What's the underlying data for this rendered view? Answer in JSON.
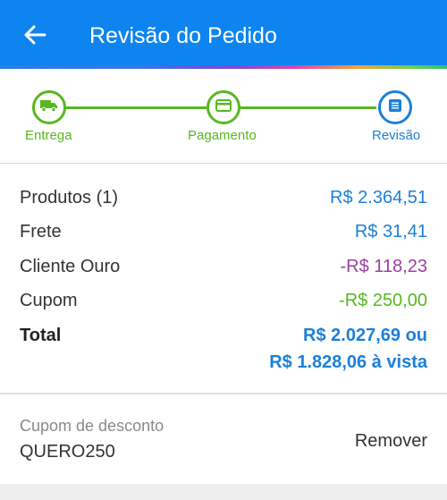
{
  "header": {
    "title": "Revisão do Pedido",
    "back_icon": "arrow-left-icon",
    "background": "#0d84f0"
  },
  "stepper": {
    "steps": [
      {
        "label": "Entrega",
        "icon": "truck-icon",
        "state": "done"
      },
      {
        "label": "Pagamento",
        "icon": "credit-card-icon",
        "state": "done"
      },
      {
        "label": "Revisão",
        "icon": "document-icon",
        "state": "current"
      }
    ],
    "done_color": "#57b820",
    "current_color": "#1d7fd8"
  },
  "summary": {
    "rows": [
      {
        "label": "Produtos (1)",
        "value": "R$ 2.364,51",
        "color": "#1d7fd8"
      },
      {
        "label": "Frete",
        "value": "R$ 31,41",
        "color": "#1d7fd8"
      },
      {
        "label": "Cliente Ouro",
        "value": "-R$ 118,23",
        "color": "#9b3fa0"
      },
      {
        "label": "Cupom",
        "value": "-R$ 250,00",
        "color": "#57b820"
      }
    ],
    "total": {
      "label": "Total",
      "value_line1": "R$ 2.027,69 ou",
      "value_line2": "R$ 1.828,06 à vista",
      "color": "#1d7fd8"
    }
  },
  "coupon": {
    "label": "Cupom de desconto",
    "code": "QUERO250",
    "remove_label": "Remover"
  }
}
